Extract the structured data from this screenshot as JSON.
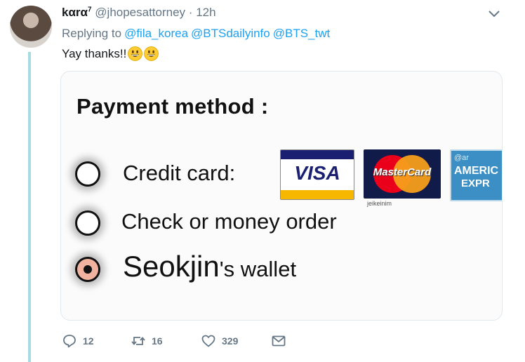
{
  "tweet": {
    "display_name": "kαrα",
    "name_superscript": "7",
    "handle": "@jhopesattorney",
    "separator": "·",
    "time": "12h",
    "replying_label": "Replying to",
    "mentions": [
      "@fila_korea",
      "@BTSdailyinfo",
      "@BTS_twt"
    ],
    "text": "Yay thanks!!",
    "emoji": [
      "grinning-face-emoji",
      "grinning-face-emoji"
    ]
  },
  "media": {
    "title": "Payment method :",
    "options": [
      {
        "label": "Credit card:",
        "selected": false
      },
      {
        "label": "Check or money order",
        "selected": false
      },
      {
        "label_main": "Seokjin",
        "label_suffix": "'s wallet",
        "selected": true
      }
    ],
    "cards": {
      "visa": "VISA",
      "mastercard": "MasterCard",
      "amex_line1": "@ar",
      "amex_line2": "AMERIC",
      "amex_line3": "EXPR"
    },
    "watermark": "jeikeinim"
  },
  "actions": {
    "replies": "12",
    "retweets": "16",
    "likes": "329"
  },
  "colors": {
    "link": "#1da1f2",
    "muted": "#657786",
    "thread_line": "#a7dbe3"
  }
}
